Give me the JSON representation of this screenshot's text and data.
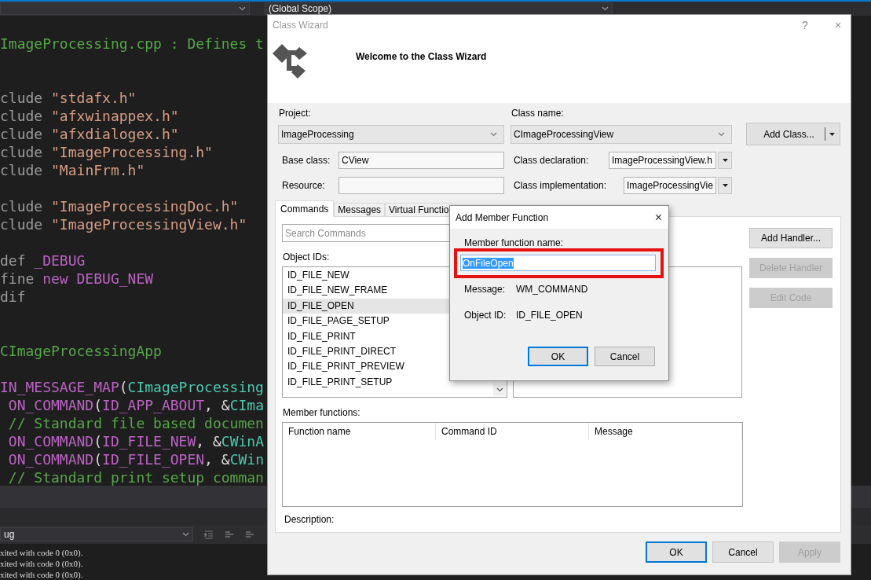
{
  "editor": {
    "scope_dropdown": "(Global Scope)",
    "code_lines": [
      {
        "kind": "code",
        "segments": [
          {
            "kind": "comment",
            "text": "ImageProcessing.cpp : Defines t"
          }
        ]
      },
      {
        "kind": "blank"
      },
      {
        "kind": "blank"
      },
      {
        "kind": "code",
        "segments": [
          {
            "kind": "directive",
            "text": "clude "
          },
          {
            "kind": "string",
            "text": "\"stdafx.h\""
          }
        ]
      },
      {
        "kind": "code",
        "segments": [
          {
            "kind": "directive",
            "text": "clude "
          },
          {
            "kind": "string",
            "text": "\"afxwinappex.h\""
          }
        ]
      },
      {
        "kind": "code",
        "segments": [
          {
            "kind": "directive",
            "text": "clude "
          },
          {
            "kind": "string",
            "text": "\"afxdialogex.h\""
          }
        ]
      },
      {
        "kind": "code",
        "segments": [
          {
            "kind": "directive",
            "text": "clude "
          },
          {
            "kind": "string",
            "text": "\"ImageProcessing.h\""
          }
        ]
      },
      {
        "kind": "code",
        "segments": [
          {
            "kind": "directive",
            "text": "clude "
          },
          {
            "kind": "string",
            "text": "\"MainFrm.h\""
          }
        ]
      },
      {
        "kind": "blank"
      },
      {
        "kind": "code",
        "segments": [
          {
            "kind": "directive",
            "text": "clude "
          },
          {
            "kind": "string",
            "text": "\"ImageProcessingDoc.h\""
          }
        ]
      },
      {
        "kind": "code",
        "segments": [
          {
            "kind": "directive",
            "text": "clude "
          },
          {
            "kind": "string",
            "text": "\"ImageProcessingView.h\""
          }
        ]
      },
      {
        "kind": "blank"
      },
      {
        "kind": "code",
        "segments": [
          {
            "kind": "directive",
            "text": "def "
          },
          {
            "kind": "macro",
            "text": "_DEBUG"
          }
        ]
      },
      {
        "kind": "code",
        "segments": [
          {
            "kind": "directive",
            "text": "fine "
          },
          {
            "kind": "macro",
            "text": "new DEBUG_NEW"
          }
        ]
      },
      {
        "kind": "code",
        "segments": [
          {
            "kind": "directive",
            "text": "dif"
          }
        ]
      },
      {
        "kind": "blank"
      },
      {
        "kind": "blank"
      },
      {
        "kind": "code",
        "segments": [
          {
            "kind": "comment",
            "text": "CImageProcessingApp"
          }
        ]
      },
      {
        "kind": "blank"
      },
      {
        "kind": "code",
        "segments": [
          {
            "kind": "macro",
            "text": "IN_MESSAGE_MAP"
          },
          {
            "kind": "plain",
            "text": "("
          },
          {
            "kind": "type",
            "text": "CImageProcessing"
          }
        ]
      },
      {
        "kind": "code",
        "segments": [
          {
            "kind": "macro",
            "text": " ON_COMMAND"
          },
          {
            "kind": "plain",
            "text": "("
          },
          {
            "kind": "macro",
            "text": "ID_APP_ABOUT"
          },
          {
            "kind": "plain",
            "text": ", &"
          },
          {
            "kind": "type",
            "text": "CIma"
          }
        ]
      },
      {
        "kind": "code",
        "segments": [
          {
            "kind": "comment",
            "text": " // Standard file based documen"
          }
        ]
      },
      {
        "kind": "code",
        "segments": [
          {
            "kind": "macro",
            "text": " ON_COMMAND"
          },
          {
            "kind": "plain",
            "text": "("
          },
          {
            "kind": "macro",
            "text": "ID_FILE_NEW"
          },
          {
            "kind": "plain",
            "text": ", &"
          },
          {
            "kind": "type",
            "text": "CWinA"
          }
        ]
      },
      {
        "kind": "code",
        "segments": [
          {
            "kind": "macro",
            "text": " ON_COMMAND"
          },
          {
            "kind": "plain",
            "text": "("
          },
          {
            "kind": "macro",
            "text": "ID_FILE_OPEN"
          },
          {
            "kind": "plain",
            "text": ", &"
          },
          {
            "kind": "type",
            "text": "CWin"
          }
        ]
      },
      {
        "kind": "code",
        "segments": [
          {
            "kind": "comment",
            "text": " // Standard print setup comman"
          }
        ]
      }
    ]
  },
  "output_panel": {
    "configuration": "ug",
    "lines": [
      "xited with code 0 (0x0).",
      "xited with code 0 (0x0).",
      "xited with code 0 (0x0)."
    ]
  },
  "class_wizard": {
    "title": "Class Wizard",
    "help_button": "?",
    "close_button": "×",
    "heading": "Welcome to the Class Wizard",
    "project": {
      "label": "Project:",
      "value": "ImageProcessing"
    },
    "class_name": {
      "label": "Class name:",
      "value": "CImageProcessingView"
    },
    "add_class_button": "Add Class...",
    "base_class": {
      "label": "Base class:",
      "value": "CView"
    },
    "resource": {
      "label": "Resource:"
    },
    "class_declaration": {
      "label": "Class declaration:",
      "value": "ImageProcessingView.h"
    },
    "class_implementation": {
      "label": "Class implementation:",
      "value": "ImageProcessingVie"
    },
    "tabs": [
      {
        "label": "Commands",
        "selected": true
      },
      {
        "label": "Messages",
        "selected": false
      },
      {
        "label": "Virtual Functio",
        "selected": false
      }
    ],
    "search": {
      "placeholder": "Search Commands"
    },
    "object_ids": {
      "label": "Object IDs:",
      "items": [
        {
          "text": "ID_FILE_NEW",
          "selected": false
        },
        {
          "text": "ID_FILE_NEW_FRAME",
          "selected": false
        },
        {
          "text": "ID_FILE_OPEN",
          "selected": true
        },
        {
          "text": "ID_FILE_PAGE_SETUP",
          "selected": false
        },
        {
          "text": "ID_FILE_PRINT",
          "selected": false
        },
        {
          "text": "ID_FILE_PRINT_DIRECT",
          "selected": false
        },
        {
          "text": "ID_FILE_PRINT_PREVIEW",
          "selected": false
        },
        {
          "text": "ID_FILE_PRINT_SETUP",
          "selected": false
        }
      ]
    },
    "handler_buttons": [
      {
        "label": "Add Handler...",
        "disabled": false
      },
      {
        "label": "Delete Handler",
        "disabled": true
      },
      {
        "label": "Edit Code",
        "disabled": true
      }
    ],
    "member_functions": {
      "label": "Member functions:",
      "columns": [
        "Function name",
        "Command ID",
        "Message"
      ]
    },
    "description": {
      "label": "Description:"
    },
    "buttons": [
      {
        "label": "OK",
        "default": true,
        "disabled": false
      },
      {
        "label": "Cancel",
        "default": false,
        "disabled": false
      },
      {
        "label": "Apply",
        "default": false,
        "disabled": true
      }
    ]
  },
  "add_member_function": {
    "title": "Add Member Function",
    "close_button": "×",
    "name_label": "Member function name:",
    "name_value": "OnFileOpen",
    "name_selected": true,
    "fields": [
      {
        "label": "Message:",
        "value": "WM_COMMAND"
      },
      {
        "label": "Object ID:",
        "value": "ID_FILE_OPEN"
      }
    ],
    "buttons": [
      {
        "label": "OK",
        "default": true
      },
      {
        "label": "Cancel",
        "default": false
      }
    ]
  }
}
